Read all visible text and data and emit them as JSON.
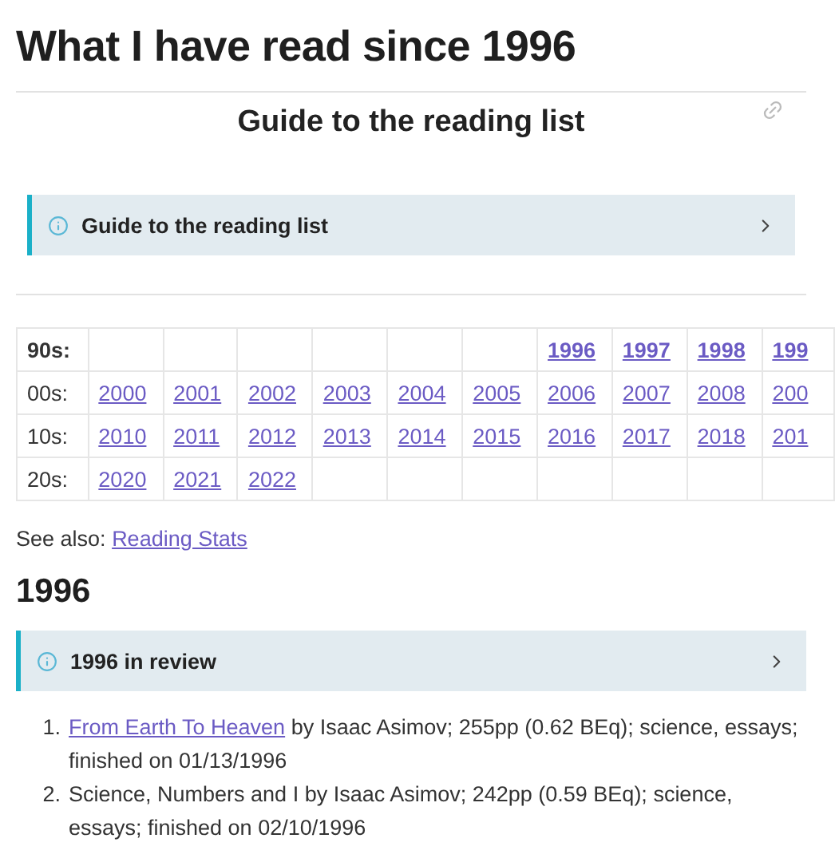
{
  "page_title": "What I have read since 1996",
  "section_heading": "Guide to the reading list",
  "guide_callout": {
    "title": "Guide to the reading list",
    "expanded": false
  },
  "year_table": {
    "rows": [
      {
        "label": "90s:",
        "selected": true,
        "cells": [
          {
            "kind": "blank"
          },
          {
            "kind": "blank"
          },
          {
            "kind": "blank"
          },
          {
            "kind": "blank"
          },
          {
            "kind": "blank"
          },
          {
            "kind": "blank"
          },
          {
            "kind": "year",
            "text": "1996"
          },
          {
            "kind": "year",
            "text": "1997"
          },
          {
            "kind": "year",
            "text": "1998"
          },
          {
            "kind": "year",
            "text": "199"
          }
        ]
      },
      {
        "label": "00s:",
        "selected": false,
        "cells": [
          {
            "kind": "year",
            "text": "2000"
          },
          {
            "kind": "year",
            "text": "2001"
          },
          {
            "kind": "year",
            "text": "2002"
          },
          {
            "kind": "year",
            "text": "2003"
          },
          {
            "kind": "year",
            "text": "2004"
          },
          {
            "kind": "year",
            "text": "2005"
          },
          {
            "kind": "year",
            "text": "2006"
          },
          {
            "kind": "year",
            "text": "2007"
          },
          {
            "kind": "year",
            "text": "2008"
          },
          {
            "kind": "year",
            "text": "200"
          }
        ]
      },
      {
        "label": "10s:",
        "selected": false,
        "cells": [
          {
            "kind": "year",
            "text": "2010"
          },
          {
            "kind": "year",
            "text": "2011"
          },
          {
            "kind": "year",
            "text": "2012"
          },
          {
            "kind": "year",
            "text": "2013"
          },
          {
            "kind": "year",
            "text": "2014"
          },
          {
            "kind": "year",
            "text": "2015"
          },
          {
            "kind": "year",
            "text": "2016"
          },
          {
            "kind": "year",
            "text": "2017"
          },
          {
            "kind": "year",
            "text": "2018"
          },
          {
            "kind": "year",
            "text": "201"
          }
        ]
      },
      {
        "label": "20s:",
        "selected": false,
        "cells": [
          {
            "kind": "year",
            "text": "2020"
          },
          {
            "kind": "year",
            "text": "2021"
          },
          {
            "kind": "year",
            "text": "2022"
          },
          {
            "kind": "blank"
          },
          {
            "kind": "blank"
          },
          {
            "kind": "blank"
          },
          {
            "kind": "blank"
          },
          {
            "kind": "blank"
          },
          {
            "kind": "blank"
          },
          {
            "kind": "blank"
          }
        ]
      }
    ]
  },
  "see_also": {
    "label": "See also:",
    "link": "Reading Stats"
  },
  "year_heading": "1996",
  "review_callout": {
    "title": "1996 in review",
    "expanded": false
  },
  "books": [
    {
      "number": "1.",
      "link": "From Earth To Heaven",
      "text": " by Isaac Asimov; 255pp (0.62 BEq); science, essays; finished on 01/13/1996"
    },
    {
      "number": "2.",
      "text": "Science, Numbers and I by Isaac Asimov; 242pp (0.59 BEq); science, essays; finished on 02/10/1996"
    }
  ]
}
